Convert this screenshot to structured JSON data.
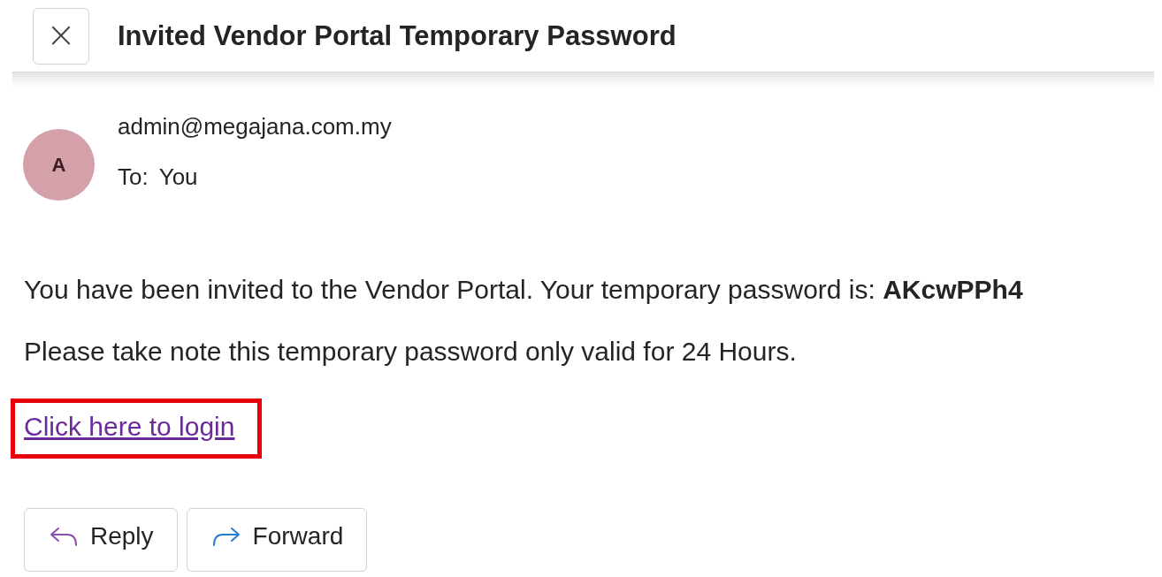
{
  "header": {
    "close_label": "×",
    "title": "Invited Vendor Portal Temporary Password"
  },
  "sender": {
    "avatar_letter": "A",
    "address": "admin@megajana.com.my",
    "to_label": "To:",
    "to_value": "You"
  },
  "body": {
    "paragraphs": [
      "You have been invited to the Vendor Portal. Your temporary password is: **AKcwPPh4**",
      "Please take note this temporary password only valid for 24 Hours."
    ],
    "link": {
      "text": "Click here to login",
      "highlighted": true
    }
  },
  "actions": [
    {
      "kind": "reply",
      "label": "Reply"
    },
    {
      "kind": "forward",
      "label": "Forward"
    }
  ]
}
